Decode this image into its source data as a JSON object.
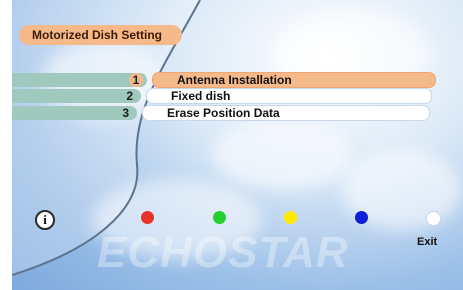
{
  "title": "Motorized Dish Setting",
  "menu": {
    "items": [
      {
        "number": "1",
        "label": "Antenna Installation",
        "active": true
      },
      {
        "number": "2",
        "label": "Fixed dish",
        "active": false
      },
      {
        "number": "3",
        "label": "Erase Position Data",
        "active": false
      }
    ]
  },
  "footer": {
    "info_symbol": "i",
    "exit_label": "Exit",
    "colors": {
      "red": "#e8332a",
      "green": "#22d12e",
      "yellow": "#ffea00",
      "blue": "#0b1fd6",
      "white": "#ffffff"
    }
  },
  "watermark": "ECHOSTAR"
}
